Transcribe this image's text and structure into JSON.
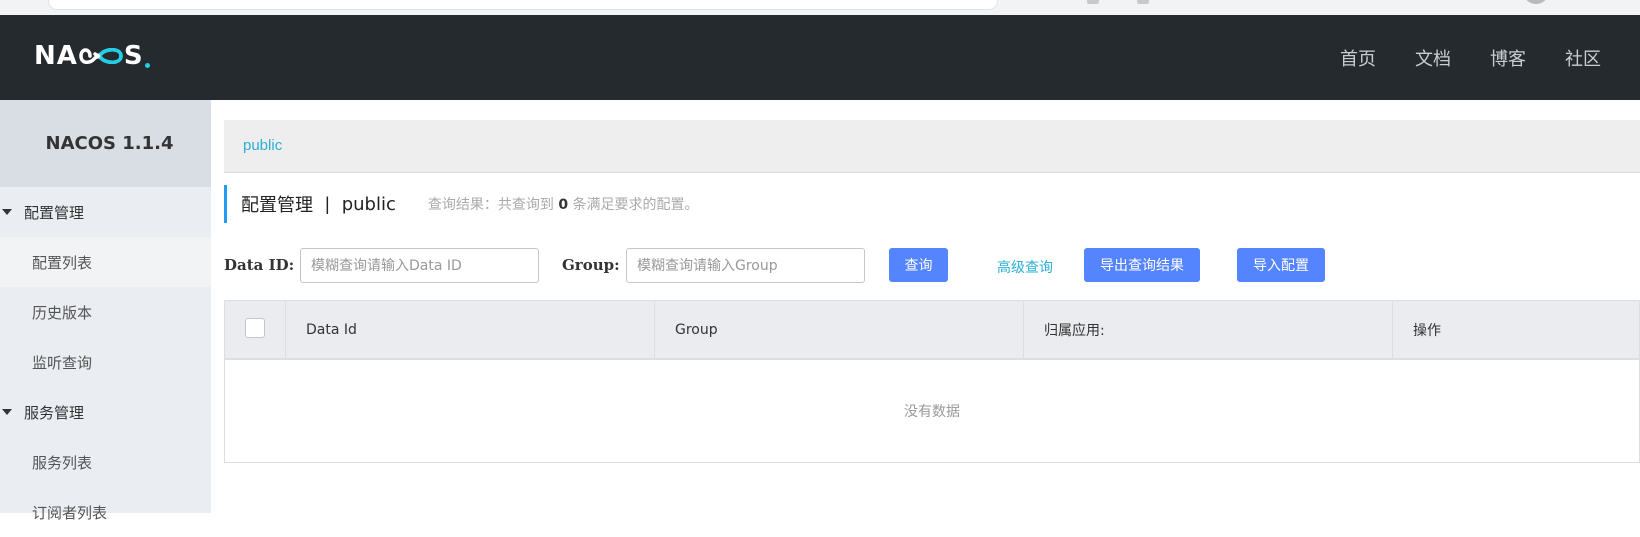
{
  "header": {
    "logo_text_left": "NA",
    "logo_text_right": "S",
    "nav": [
      "首页",
      "文档",
      "博客",
      "社区"
    ]
  },
  "sidebar": {
    "brand": "NACOS 1.1.4",
    "groups": [
      {
        "label": "配置管理",
        "items": [
          "配置列表",
          "历史版本",
          "监听查询"
        ]
      },
      {
        "label": "服务管理",
        "items": [
          "服务列表",
          "订阅者列表"
        ]
      }
    ]
  },
  "namespace_bar": {
    "label": "public"
  },
  "title": {
    "text": "配置管理",
    "separator": "|",
    "namespace": "public",
    "result_prefix": "查询结果：共查询到",
    "result_count": "0",
    "result_suffix": "条满足要求的配置。"
  },
  "filter": {
    "data_id_label": "Data ID:",
    "data_id_placeholder": "模糊查询请输入Data ID",
    "group_label": "Group:",
    "group_placeholder": "模糊查询请输入Group",
    "query_button": "查询",
    "advanced_link": "高级查询",
    "export_button": "导出查询结果",
    "import_button": "导入配置"
  },
  "table": {
    "columns": [
      "Data Id",
      "Group",
      "归属应用:",
      "操作"
    ],
    "empty_text": "没有数据"
  },
  "colors": {
    "header_bg": "#252a2f",
    "accent_blue": "#5584ff",
    "link_cyan": "#2ab0d4"
  }
}
